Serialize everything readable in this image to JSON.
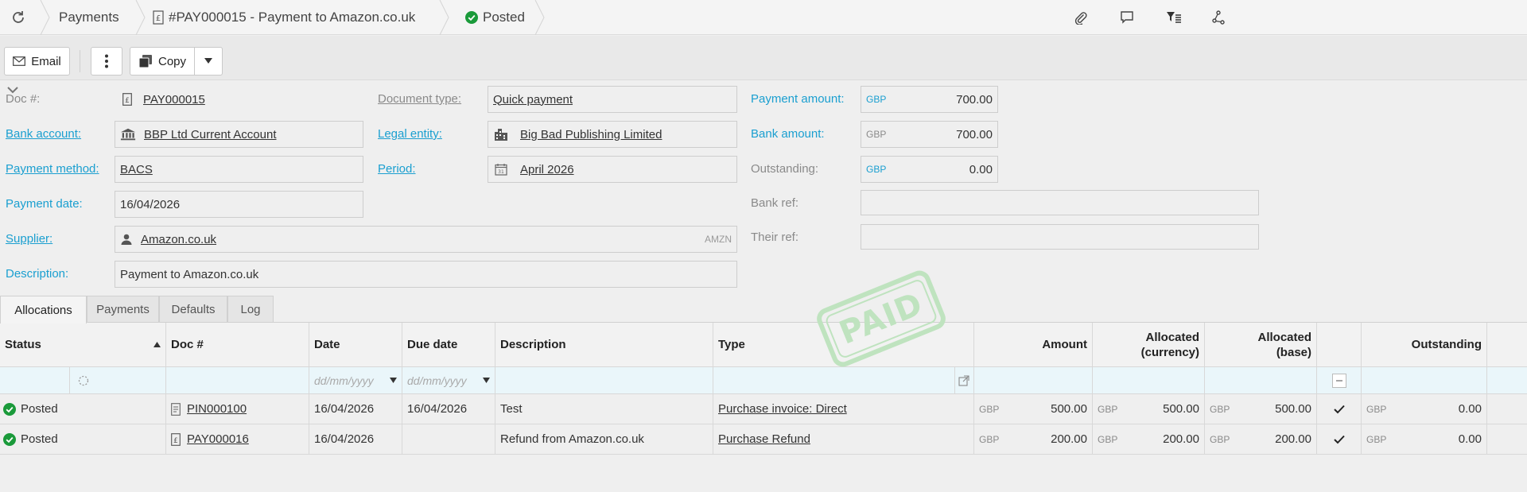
{
  "breadcrumb": {
    "section": "Payments",
    "document": "#PAY000015 - Payment to Amazon.co.uk",
    "status": "Posted"
  },
  "toolbar": {
    "email_label": "Email",
    "copy_label": "Copy"
  },
  "form": {
    "doc_no": {
      "label": "Doc #:",
      "value": "PAY000015"
    },
    "bank_account": {
      "label": "Bank account:",
      "value": "BBP Ltd Current Account"
    },
    "payment_method": {
      "label": "Payment method:",
      "value": "BACS"
    },
    "payment_date": {
      "label": "Payment date:",
      "value": "16/04/2026"
    },
    "supplier": {
      "label": "Supplier:",
      "value": "Amazon.co.uk",
      "code": "AMZN"
    },
    "description": {
      "label": "Description:",
      "value": "Payment to Amazon.co.uk"
    },
    "document_type": {
      "label": "Document type:",
      "value": "Quick payment"
    },
    "legal_entity": {
      "label": "Legal entity:",
      "value": "Big Bad Publishing Limited"
    },
    "period": {
      "label": "Period:",
      "value": "April 2026"
    },
    "payment_amount": {
      "label": "Payment amount:",
      "currency": "GBP",
      "value": "700.00"
    },
    "bank_amount": {
      "label": "Bank amount:",
      "currency": "GBP",
      "value": "700.00"
    },
    "outstanding": {
      "label": "Outstanding:",
      "currency": "GBP",
      "value": "0.00"
    },
    "bank_ref": {
      "label": "Bank ref:",
      "value": ""
    },
    "their_ref": {
      "label": "Their ref:",
      "value": ""
    }
  },
  "stamp": "PAID",
  "tabs": [
    "Allocations",
    "Payments",
    "Defaults",
    "Log"
  ],
  "grid": {
    "headers": {
      "status": "Status",
      "doc_no": "Doc #",
      "date": "Date",
      "due_date": "Due date",
      "description": "Description",
      "type": "Type",
      "amount": "Amount",
      "alloc_currency_1": "Allocated",
      "alloc_currency_2": "(currency)",
      "alloc_base_1": "Allocated",
      "alloc_base_2": "(base)",
      "outstanding": "Outstanding"
    },
    "filter": {
      "date_placeholder": "dd/mm/yyyy",
      "due_date_placeholder": "dd/mm/yyyy"
    },
    "rows": [
      {
        "status": "Posted",
        "doc_no": "PIN000100",
        "date": "16/04/2026",
        "due_date": "16/04/2026",
        "description": "Test",
        "type": "Purchase invoice: Direct",
        "amount_cur": "GBP",
        "amount": "500.00",
        "alloc_cur": "GBP",
        "alloc": "500.00",
        "alloc_base_cur": "GBP",
        "alloc_base": "500.00",
        "out_cur": "GBP",
        "outstanding": "0.00"
      },
      {
        "status": "Posted",
        "doc_no": "PAY000016",
        "date": "16/04/2026",
        "due_date": "",
        "description": "Refund from Amazon.co.uk",
        "type": "Purchase Refund",
        "amount_cur": "GBP",
        "amount": "200.00",
        "alloc_cur": "GBP",
        "alloc": "200.00",
        "alloc_base_cur": "GBP",
        "alloc_base": "200.00",
        "out_cur": "GBP",
        "outstanding": "0.00"
      }
    ]
  },
  "colors": {
    "accent": "#1a9fd0",
    "posted": "#1a9a3a",
    "stamp": "#bfe3bf"
  }
}
